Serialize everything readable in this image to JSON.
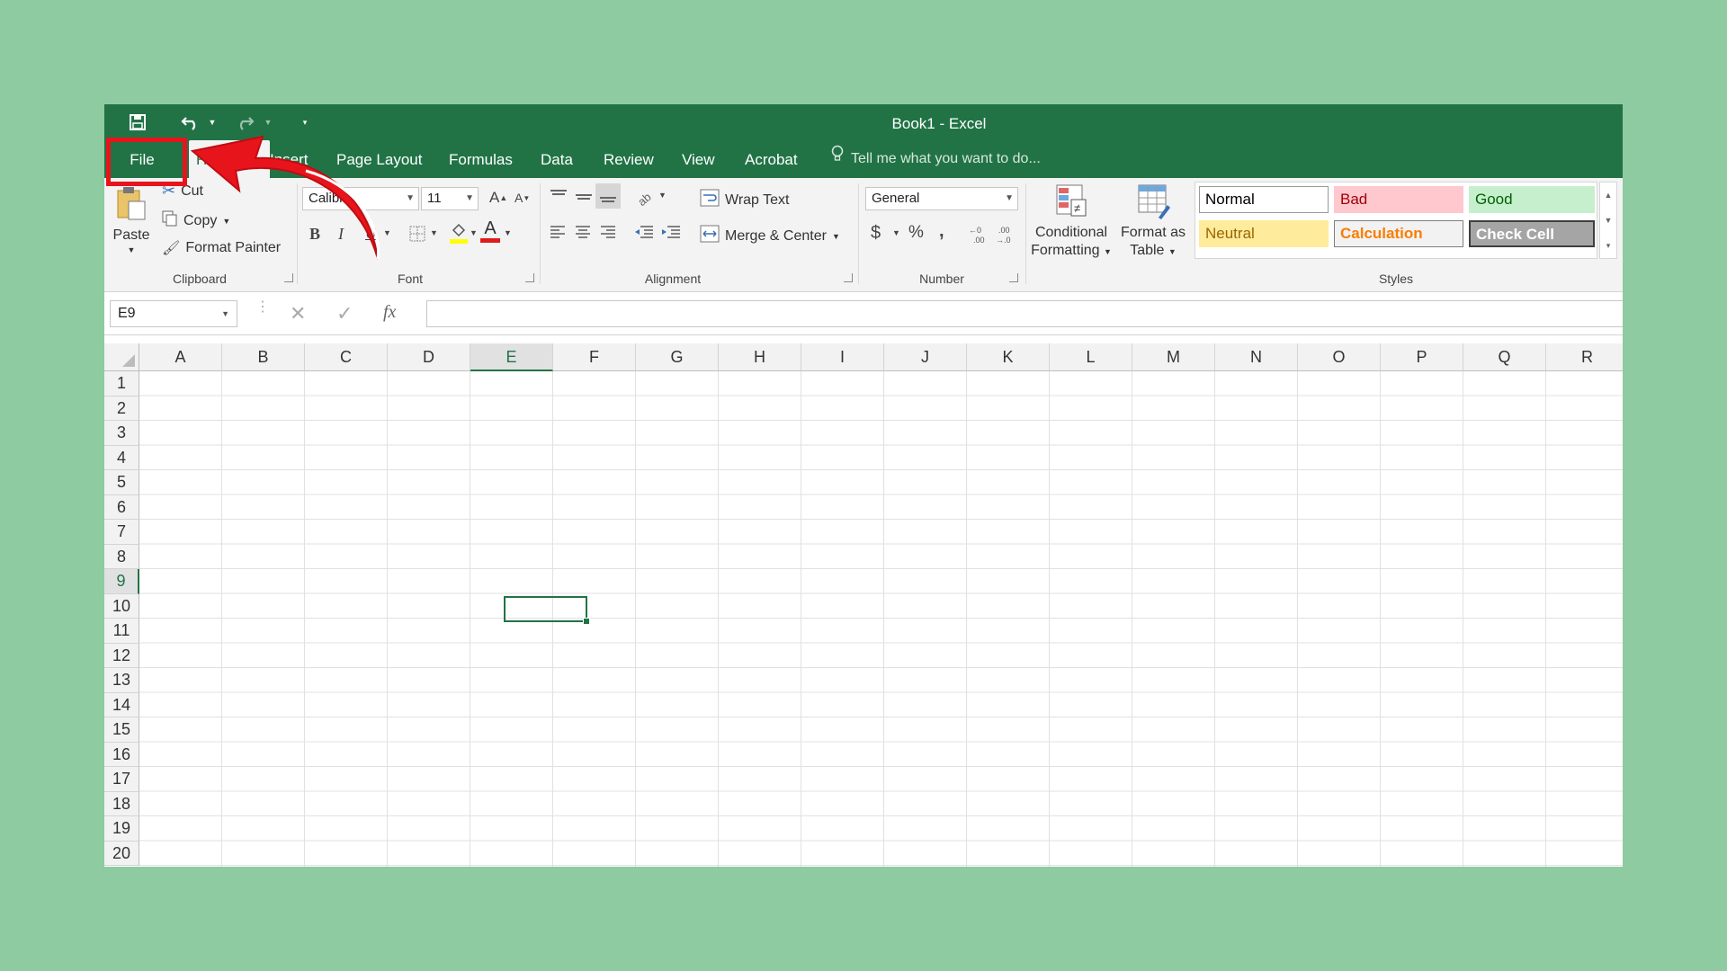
{
  "window": {
    "title": "Book1 - Excel"
  },
  "qat": {
    "save_icon": "save-icon",
    "undo_icon": "undo-icon",
    "redo_icon": "redo-icon",
    "customize_icon": "customize-qat-icon"
  },
  "tabs": [
    {
      "label": "File"
    },
    {
      "label": "Home"
    },
    {
      "label": "Insert"
    },
    {
      "label": "Page Layout"
    },
    {
      "label": "Formulas"
    },
    {
      "label": "Data"
    },
    {
      "label": "Review"
    },
    {
      "label": "View"
    },
    {
      "label": "Acrobat"
    }
  ],
  "tell_me": {
    "placeholder": "Tell me what you want to do..."
  },
  "clipboard": {
    "paste": "Paste",
    "cut": "Cut",
    "copy": "Copy",
    "format_painter": "Format Painter",
    "group": "Clipboard"
  },
  "font": {
    "name": "Calibri",
    "size": "11",
    "group": "Font",
    "bold": "B",
    "italic": "I",
    "underline": "U"
  },
  "alignment": {
    "wrap_text": "Wrap Text",
    "merge_center": "Merge & Center",
    "group": "Alignment"
  },
  "number": {
    "format": "General",
    "currency": "$",
    "percent": "%",
    "comma": ",",
    "group": "Number"
  },
  "styles_group": {
    "conditional_formatting": [
      "Conditional",
      "Formatting"
    ],
    "format_as_table": [
      "Format as",
      "Table"
    ],
    "group": "Styles",
    "cells": [
      {
        "label": "Normal",
        "bg": "#FFFFFF",
        "color": "#000000",
        "border": "#9a9a9a"
      },
      {
        "label": "Bad",
        "bg": "#FFC7CE",
        "color": "#9C0006",
        "border": "#FFC7CE"
      },
      {
        "label": "Good",
        "bg": "#C6EFCE",
        "color": "#006100",
        "border": "#C6EFCE"
      },
      {
        "label": "Neutral",
        "bg": "#FFEB9C",
        "color": "#9C6500",
        "border": "#FFEB9C"
      },
      {
        "label": "Calculation",
        "bg": "#F2F2F2",
        "color": "#FA7D00",
        "border": "#7F7F7F"
      },
      {
        "label": "Check Cell",
        "bg": "#A5A5A5",
        "color": "#FFFFFF",
        "border": "#3F3F3F"
      }
    ]
  },
  "formula_bar": {
    "name_box": "E9",
    "fx": "fx",
    "formula": ""
  },
  "sheet": {
    "columns": [
      "A",
      "B",
      "C",
      "D",
      "E",
      "F",
      "G",
      "H",
      "I",
      "J",
      "K",
      "L",
      "M",
      "N",
      "O",
      "P",
      "Q",
      "R"
    ],
    "rows": [
      "1",
      "2",
      "3",
      "4",
      "5",
      "6",
      "7",
      "8",
      "9",
      "10",
      "11",
      "12",
      "13",
      "14",
      "15",
      "16",
      "17",
      "18",
      "19",
      "20"
    ],
    "active_cell": "E9",
    "active_column": "E",
    "active_row": "9"
  },
  "colors": {
    "excel_green": "#217346",
    "background": "#8ECBA0",
    "highlight_red": "#E8141C"
  }
}
